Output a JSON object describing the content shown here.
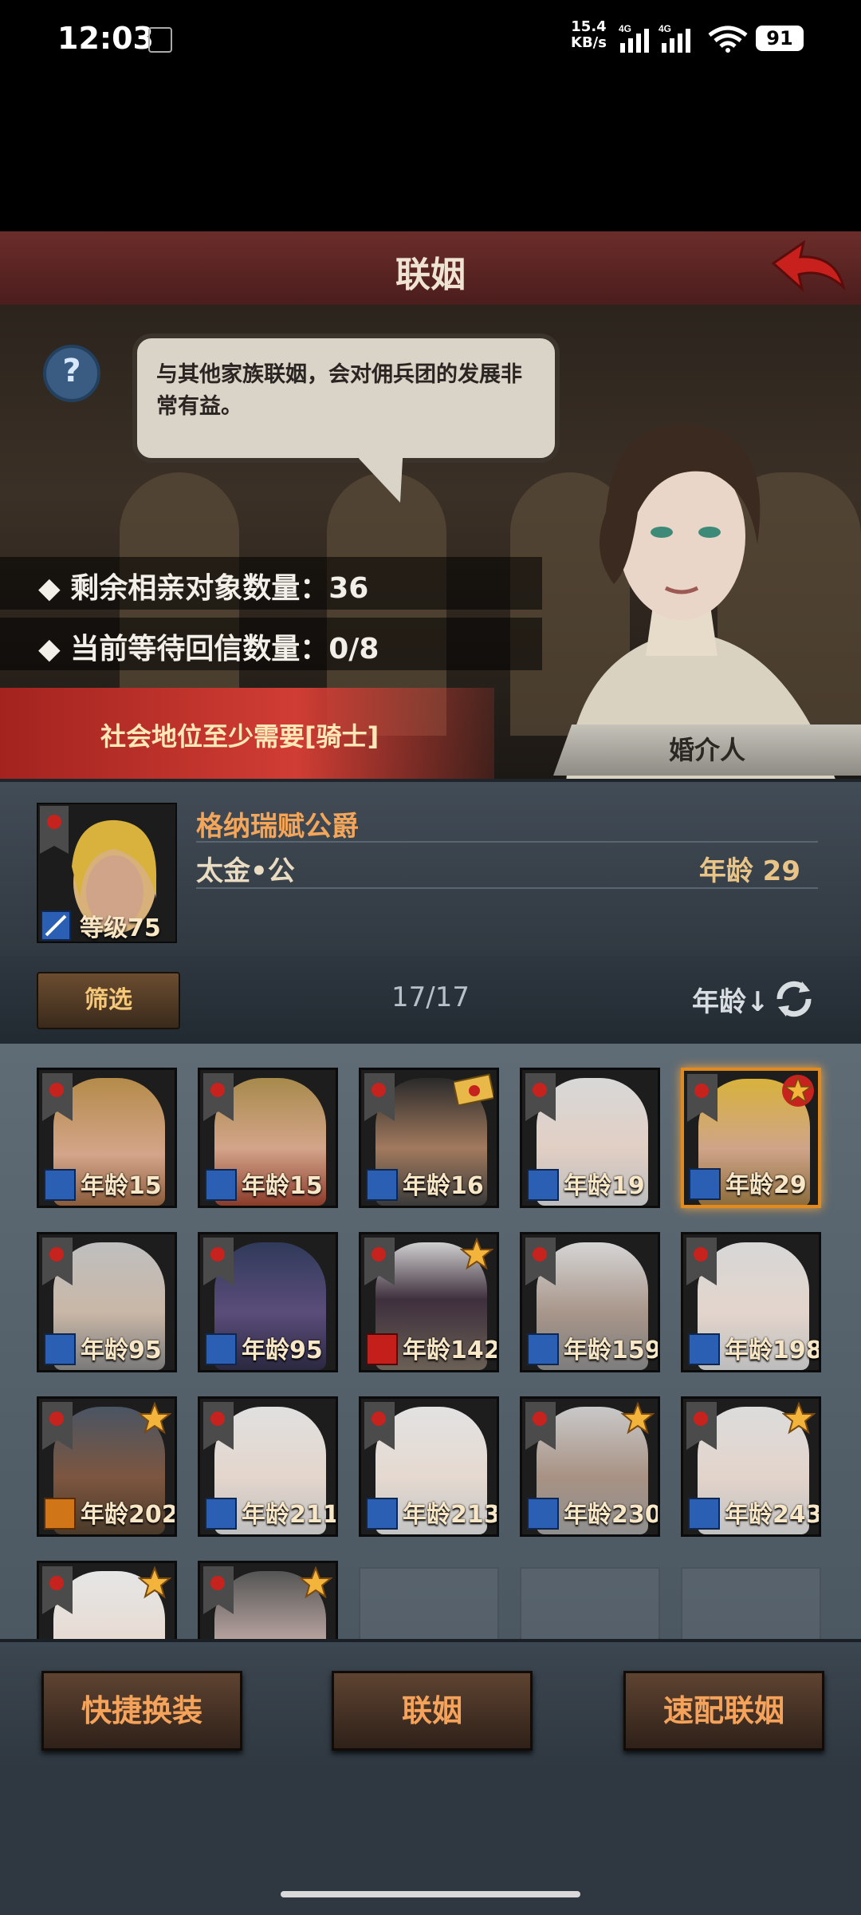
{
  "status_bar": {
    "time": "12:03",
    "speed_value": "15.4",
    "speed_unit": "KB/s",
    "net1": "4G",
    "net2": "4G",
    "battery": "91"
  },
  "header": {
    "title": "联姻"
  },
  "scene": {
    "speech": "与其他家族联姻，会对佣兵团的发展非常有益。",
    "remaining_label": "◆ 剩余相亲对象数量：36",
    "waiting_label": "◆ 当前等待回信数量：0/8",
    "requirement": "社会地位至少需要[骑士]",
    "matchmaker": "婚介人"
  },
  "character": {
    "name": "格纳瑞赋公爵",
    "house": "太金•公",
    "age": "年龄 29",
    "level": "等级75"
  },
  "filter": {
    "button": "筛选",
    "count": "17/17",
    "sort": "年龄↓"
  },
  "candidates": [
    {
      "age": "年龄15",
      "class": "blue"
    },
    {
      "age": "年龄15",
      "class": "blue"
    },
    {
      "age": "年龄16",
      "class": "blue"
    },
    {
      "age": "年龄19",
      "class": "blue"
    },
    {
      "age": "年龄29",
      "class": "blue"
    },
    {
      "age": "年龄95",
      "class": "blue"
    },
    {
      "age": "年龄95",
      "class": "blue"
    },
    {
      "age": "年龄142",
      "class": "red"
    },
    {
      "age": "年龄159",
      "class": "blue"
    },
    {
      "age": "年龄198",
      "class": "blue"
    },
    {
      "age": "年龄202",
      "class": "orange"
    },
    {
      "age": "年龄211",
      "class": "blue"
    },
    {
      "age": "年龄213",
      "class": "blue"
    },
    {
      "age": "年龄230",
      "class": "blue"
    },
    {
      "age": "年龄243",
      "class": "blue"
    }
  ],
  "buttons": {
    "quick_equip": "快捷换装",
    "marry": "联姻",
    "quick_match": "速配联姻"
  },
  "colors": {
    "accent_orange": "#f5a35a",
    "header_red": "#6b2d2a",
    "requirement_red": "#d03d34",
    "selected_border": "#e08a1f"
  }
}
